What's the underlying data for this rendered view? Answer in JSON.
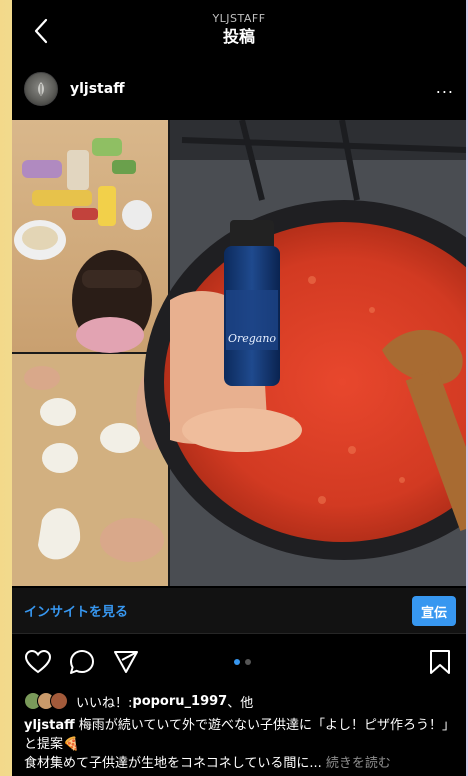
{
  "header": {
    "subtitle": "YLJSTAFF",
    "title": "投稿",
    "back_icon": "chevron-left-icon"
  },
  "profile": {
    "username": "yljstaff",
    "more_label": "..."
  },
  "post": {
    "insight_label": "インサイトを見る",
    "promote_label": "宣伝",
    "carousel": {
      "current": 1,
      "total": 2
    },
    "likes": {
      "prefix": "いいね！: ",
      "user": "poporu_1997",
      "suffix": "、他"
    },
    "caption": {
      "username": "yljstaff",
      "line1": " 梅雨が続いていて外で遊べない子供達に「よし！ピザ作ろう！」と提案🍕",
      "line2": "食材集めて子供達が生地をコネコネしている間に...",
      "more": " 続きを読む"
    },
    "bottle_label": "Oregano"
  },
  "colors": {
    "accent": "#3797f0",
    "background": "#000000",
    "text": "#ffffff",
    "muted": "#8e8e8e"
  }
}
